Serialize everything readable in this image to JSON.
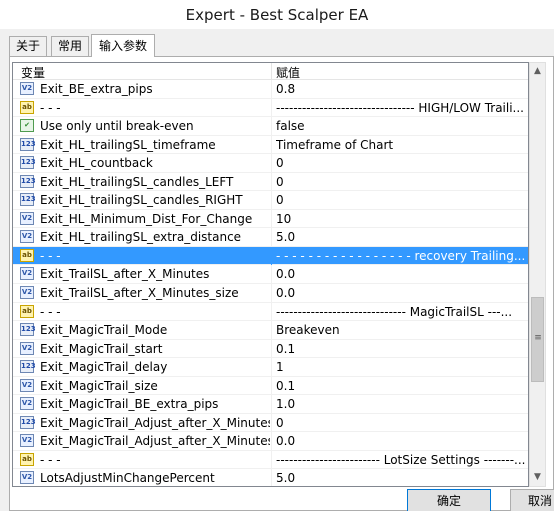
{
  "window": {
    "title": "Expert - Best Scalper EA"
  },
  "tabs": [
    {
      "label": "关于"
    },
    {
      "label": "常用"
    },
    {
      "label": "输入参数"
    }
  ],
  "grid": {
    "col_variable": "变量",
    "col_value": "赋值",
    "rows": [
      {
        "icon": "double-icon",
        "name": "Exit_BE_extra_pips",
        "value": "0.8",
        "selected": false
      },
      {
        "icon": "string-icon",
        "name": "- - -",
        "value": "-------------------------------- HIGH/LOW Traili...",
        "selected": false
      },
      {
        "icon": "bool-icon",
        "name": "Use only until break-even",
        "value": "false",
        "selected": false
      },
      {
        "icon": "int-icon",
        "name": "Exit_HL_trailingSL_timeframe",
        "value": "Timeframe of Chart",
        "selected": false
      },
      {
        "icon": "int-icon",
        "name": "Exit_HL_countback",
        "value": "0",
        "selected": false
      },
      {
        "icon": "int-icon",
        "name": "Exit_HL_trailingSL_candles_LEFT",
        "value": "0",
        "selected": false
      },
      {
        "icon": "int-icon",
        "name": "Exit_HL_trailingSL_candles_RIGHT",
        "value": "0",
        "selected": false
      },
      {
        "icon": "double-icon",
        "name": "Exit_HL_Minimum_Dist_For_Change",
        "value": "10",
        "selected": false
      },
      {
        "icon": "double-icon",
        "name": "Exit_HL_trailingSL_extra_distance",
        "value": "5.0",
        "selected": false
      },
      {
        "icon": "string-icon",
        "name": "- - -",
        "value": "- - - - - - - - - - - - - - - - - recovery Trailing...",
        "selected": true
      },
      {
        "icon": "double-icon",
        "name": "Exit_TrailSL_after_X_Minutes",
        "value": "0.0",
        "selected": false
      },
      {
        "icon": "double-icon",
        "name": "Exit_TrailSL_after_X_Minutes_size",
        "value": "0.0",
        "selected": false
      },
      {
        "icon": "string-icon",
        "name": "- - -",
        "value": "------------------------------ MagicTrailSL ---...",
        "selected": false
      },
      {
        "icon": "int-icon",
        "name": "Exit_MagicTrail_Mode",
        "value": "Breakeven",
        "selected": false
      },
      {
        "icon": "double-icon",
        "name": "Exit_MagicTrail_start",
        "value": "0.1",
        "selected": false
      },
      {
        "icon": "int-icon",
        "name": "Exit_MagicTrail_delay",
        "value": "1",
        "selected": false
      },
      {
        "icon": "double-icon",
        "name": "Exit_MagicTrail_size",
        "value": "0.1",
        "selected": false
      },
      {
        "icon": "double-icon",
        "name": "Exit_MagicTrail_BE_extra_pips",
        "value": "1.0",
        "selected": false
      },
      {
        "icon": "int-icon",
        "name": "Exit_MagicTrail_Adjust_after_X_Minutes",
        "value": "0",
        "selected": false
      },
      {
        "icon": "double-icon",
        "name": "Exit_MagicTrail_Adjust_after_X_Minutes_s...",
        "value": "0.0",
        "selected": false
      },
      {
        "icon": "string-icon",
        "name": "- - -",
        "value": "------------------------ LotSize Settings -------...",
        "selected": false
      },
      {
        "icon": "double-icon",
        "name": "LotsAdjustMinChangePercent",
        "value": "5.0",
        "selected": false
      }
    ]
  },
  "buttons": {
    "ok": "确定",
    "cancel": "取消"
  },
  "scrollbar": {
    "up": "▲",
    "down": "▼",
    "grip": "≡"
  }
}
